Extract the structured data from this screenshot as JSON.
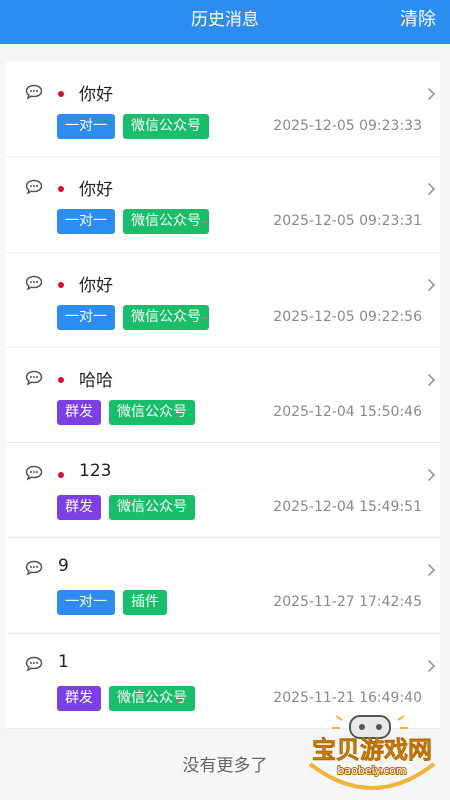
{
  "header": {
    "title": "历史消息",
    "clear_label": "清除"
  },
  "messages": [
    {
      "text": "你好",
      "unread": true,
      "tags": [
        {
          "label": "一对一",
          "color": "blue"
        },
        {
          "label": "微信公众号",
          "color": "green"
        }
      ],
      "time": "2025-12-05 09:23:33"
    },
    {
      "text": "你好",
      "unread": true,
      "tags": [
        {
          "label": "一对一",
          "color": "blue"
        },
        {
          "label": "微信公众号",
          "color": "green"
        }
      ],
      "time": "2025-12-05 09:23:31"
    },
    {
      "text": "你好",
      "unread": true,
      "tags": [
        {
          "label": "一对一",
          "color": "blue"
        },
        {
          "label": "微信公众号",
          "color": "green"
        }
      ],
      "time": "2025-12-05 09:22:56"
    },
    {
      "text": "哈哈",
      "unread": true,
      "tags": [
        {
          "label": "群发",
          "color": "purple"
        },
        {
          "label": "微信公众号",
          "color": "green"
        }
      ],
      "time": "2025-12-04 15:50:46"
    },
    {
      "text": "123",
      "unread": true,
      "tags": [
        {
          "label": "群发",
          "color": "purple"
        },
        {
          "label": "微信公众号",
          "color": "green"
        }
      ],
      "time": "2025-12-04 15:49:51"
    },
    {
      "text": "9",
      "unread": false,
      "tags": [
        {
          "label": "一对一",
          "color": "blue"
        },
        {
          "label": "插件",
          "color": "green"
        }
      ],
      "time": "2025-11-27 17:42:45"
    },
    {
      "text": "1",
      "unread": false,
      "tags": [
        {
          "label": "群发",
          "color": "purple"
        },
        {
          "label": "微信公众号",
          "color": "green"
        }
      ],
      "time": "2025-11-21 16:49:40"
    }
  ],
  "footer": {
    "no_more": "没有更多了"
  },
  "watermark": {
    "name": "宝贝游戏网",
    "url": "baobeiy.com"
  },
  "colors": {
    "primary": "#2c8cf0",
    "green": "#19be6b",
    "purple": "#7b3fe4",
    "unread_dot": "#d3132d"
  },
  "icons": {
    "message": "chat-bubble-icon",
    "arrow": "chevron-right-icon"
  }
}
